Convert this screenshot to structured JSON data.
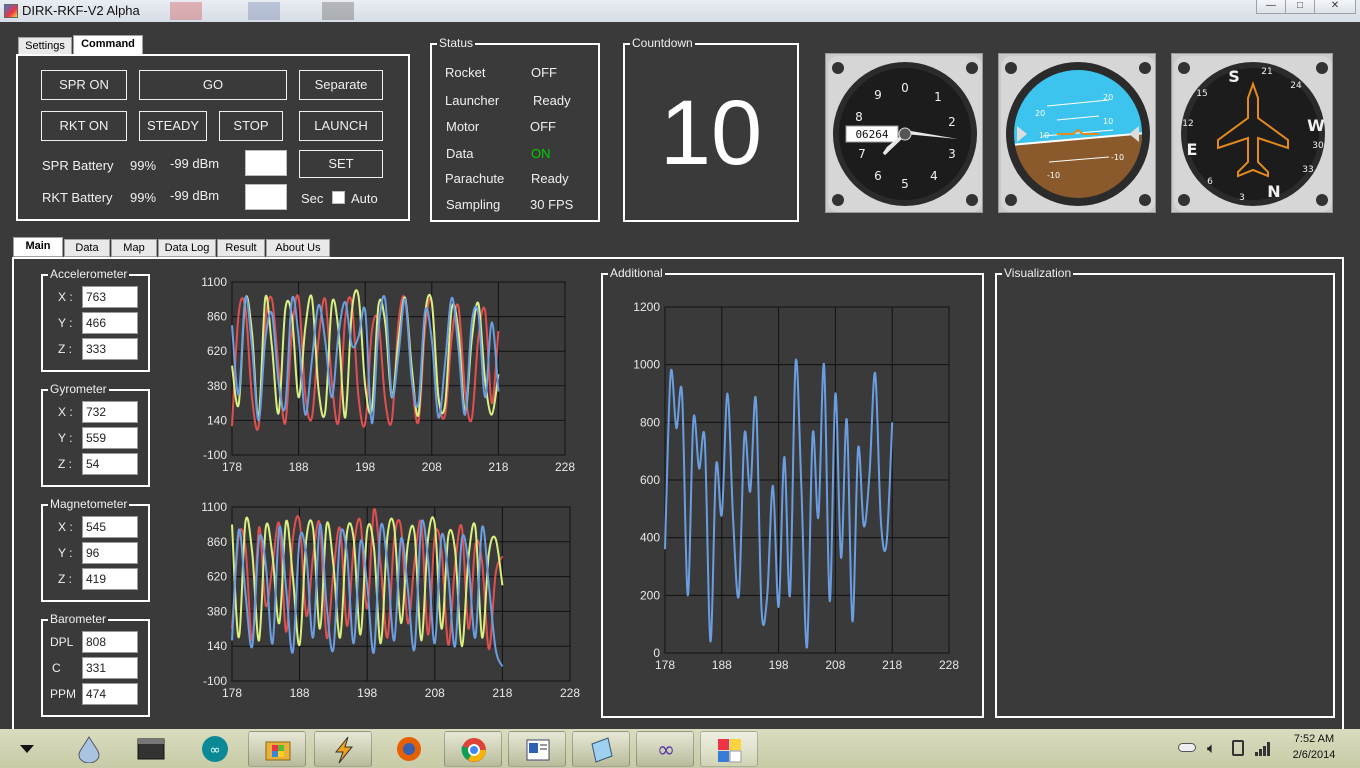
{
  "window": {
    "title": "DIRK-RKF-V2 Alpha",
    "controls": {
      "minimize": "—",
      "maximize": "□",
      "close": "✕"
    }
  },
  "top_tabs": {
    "settings": "Settings",
    "command": "Command"
  },
  "command": {
    "spr_on": "SPR ON",
    "go": "GO",
    "separate": "Separate",
    "rkt_on": "RKT ON",
    "steady": "STEADY",
    "stop": "STOP",
    "launch": "LAUNCH",
    "spr_battery": {
      "label": "SPR Battery",
      "pct": "99%",
      "dbm": "-99 dBm"
    },
    "rkt_battery": {
      "label": "RKT Battery",
      "pct": "99%",
      "dbm": "-99 dBm"
    },
    "set": "SET",
    "sec": "Sec",
    "auto": "Auto"
  },
  "status": {
    "title": "Status",
    "rows": [
      {
        "label": "Rocket",
        "value": "OFF"
      },
      {
        "label": "Launcher",
        "value": "Ready"
      },
      {
        "label": "Motor",
        "value": "OFF"
      },
      {
        "label": "Data",
        "value": "ON"
      },
      {
        "label": "Parachute",
        "value": "Ready"
      },
      {
        "label": "Sampling",
        "value": "30 FPS"
      }
    ],
    "on_color": "#00d000"
  },
  "countdown": {
    "title": "Countdown",
    "value": "10"
  },
  "gauges": {
    "altimeter": {
      "numbers": [
        "0",
        "1",
        "2",
        "3",
        "4",
        "5",
        "6",
        "7",
        "8",
        "9"
      ],
      "counter": "06264"
    },
    "attitude": {
      "pitch_labels": [
        "20",
        "10",
        "-10"
      ]
    },
    "heading": {
      "letters": [
        "S",
        "W",
        "N",
        "E"
      ],
      "numbers": [
        "21",
        "24",
        "30",
        "33",
        "3",
        "6",
        "12",
        "15"
      ]
    }
  },
  "main_tabs": [
    "Main",
    "Data",
    "Map",
    "Data Log",
    "Result",
    "About Us"
  ],
  "sensors": {
    "accelerometer": {
      "title": "Accelerometer",
      "rows": [
        {
          "label": "X :",
          "value": "763"
        },
        {
          "label": "Y :",
          "value": "466"
        },
        {
          "label": "Z :",
          "value": "333"
        }
      ]
    },
    "gyrometer": {
      "title": "Gyrometer",
      "rows": [
        {
          "label": "X :",
          "value": "732"
        },
        {
          "label": "Y :",
          "value": "559"
        },
        {
          "label": "Z :",
          "value": "54"
        }
      ]
    },
    "magnetometer": {
      "title": "Magnetometer",
      "rows": [
        {
          "label": "X :",
          "value": "545"
        },
        {
          "label": "Y :",
          "value": "96"
        },
        {
          "label": "Z :",
          "value": "419"
        }
      ]
    },
    "barometer": {
      "title": "Barometer",
      "rows": [
        {
          "label": "DPL",
          "value": "808"
        },
        {
          "label": "C",
          "value": "331"
        },
        {
          "label": "PPM",
          "value": "474"
        }
      ]
    }
  },
  "panels": {
    "additional": "Additional",
    "visualization": "Visualization"
  },
  "chart_data": [
    {
      "type": "line",
      "x": [
        178,
        179,
        180,
        181,
        182,
        183,
        184,
        185,
        186,
        187,
        188,
        189,
        190,
        191,
        192,
        193,
        194,
        195,
        196,
        197,
        198,
        199,
        200,
        201,
        202,
        203,
        204,
        205,
        206,
        207,
        208,
        209,
        210,
        211,
        212,
        213,
        214,
        215,
        216,
        217,
        218
      ],
      "series": [
        {
          "values": [
            100,
            880,
            920,
            300,
            100,
            820,
            980,
            500,
            120,
            760,
            990,
            320,
            160,
            700,
            980,
            400,
            130,
            850,
            950,
            300,
            120,
            760,
            820,
            280,
            140,
            820,
            980,
            420,
            130,
            780,
            960,
            300,
            180,
            720,
            930,
            340,
            150,
            720,
            900,
            260,
            760
          ],
          "color": "#e05050"
        },
        {
          "values": [
            520,
            250,
            980,
            750,
            160,
            990,
            650,
            190,
            910,
            860,
            300,
            780,
            990,
            350,
            200,
            950,
            760,
            160,
            900,
            1000,
            380,
            220,
            940,
            820,
            300,
            700,
            990,
            500,
            180,
            880,
            960,
            300,
            250,
            920,
            760,
            200,
            700,
            950,
            420,
            180,
            460
          ],
          "color": "#d8f080"
        },
        {
          "values": [
            800,
            320,
            990,
            650,
            140,
            700,
            880,
            400,
            240,
            980,
            720,
            180,
            560,
            940,
            690,
            300,
            740,
            960,
            660,
            720,
            900,
            120,
            780,
            980,
            310,
            600,
            980,
            420,
            260,
            900,
            700,
            160,
            540,
            990,
            640,
            180,
            820,
            880,
            300,
            820,
            340
          ],
          "color": "#6a9ee0"
        }
      ],
      "xlim": [
        178,
        228
      ],
      "ylim": [
        -100,
        1100
      ],
      "yticks": [
        -100,
        140,
        380,
        620,
        860,
        1100
      ],
      "xticks": [
        178,
        188,
        198,
        208,
        218,
        228
      ],
      "grid": true
    },
    {
      "type": "line",
      "x": [
        178,
        179,
        180,
        181,
        182,
        183,
        184,
        185,
        186,
        187,
        188,
        189,
        190,
        191,
        192,
        193,
        194,
        195,
        196,
        197,
        198,
        199,
        200,
        201,
        202,
        203,
        204,
        205,
        206,
        207,
        208,
        209,
        210,
        211,
        212,
        213,
        214,
        215,
        216,
        217,
        218
      ],
      "series": [
        {
          "values": [
            260,
            900,
            820,
            180,
            960,
            420,
            700,
            980,
            240,
            880,
            1000,
            350,
            760,
            980,
            200,
            650,
            950,
            280,
            820,
            1000,
            400,
            1080,
            700,
            200,
            880,
            960,
            300,
            720,
            990,
            220,
            900,
            800,
            150,
            700,
            960,
            260,
            840,
            720,
            120,
            640,
            760
          ],
          "color": "#e05050"
        },
        {
          "values": [
            980,
            200,
            1000,
            780,
            180,
            960,
            760,
            300,
            1000,
            620,
            150,
            880,
            950,
            260,
            980,
            700,
            200,
            920,
            880,
            220,
            940,
            820,
            160,
            900,
            960,
            300,
            840,
            920,
            180,
            880,
            980,
            260,
            900,
            800,
            140,
            760,
            960,
            200,
            780,
            880,
            560
          ],
          "color": "#d8f080"
        },
        {
          "values": [
            180,
            940,
            500,
            140,
            880,
            700,
            160,
            960,
            540,
            100,
            880,
            760,
            200,
            980,
            420,
            120,
            900,
            780,
            160,
            860,
            560,
            100,
            960,
            700,
            180,
            880,
            540,
            120,
            980,
            740,
            160,
            900,
            620,
            140,
            880,
            700,
            200,
            960,
            560,
            120,
            0
          ],
          "color": "#6a9ee0"
        }
      ],
      "xlim": [
        178,
        228
      ],
      "ylim": [
        -100,
        1100
      ],
      "yticks": [
        -100,
        140,
        380,
        620,
        860,
        1100
      ],
      "xticks": [
        178,
        188,
        198,
        208,
        218,
        228
      ],
      "grid": true
    },
    {
      "type": "line",
      "x": [
        178,
        179,
        180,
        181,
        182,
        183,
        184,
        185,
        186,
        187,
        188,
        189,
        190,
        191,
        192,
        193,
        194,
        195,
        196,
        197,
        198,
        199,
        200,
        201,
        202,
        203,
        204,
        205,
        206,
        207,
        208,
        209,
        210,
        211,
        212,
        213,
        214,
        215,
        216,
        217,
        218
      ],
      "series": [
        {
          "values": [
            360,
            970,
            780,
            900,
            200,
            810,
            640,
            740,
            40,
            650,
            480,
            900,
            460,
            200,
            760,
            560,
            880,
            150,
            200,
            580,
            160,
            680,
            200,
            1010,
            580,
            20,
            760,
            470,
            1000,
            180,
            900,
            330,
            810,
            110,
            710,
            440,
            620,
            970,
            460,
            380,
            800
          ],
          "color": "#6a9ee0"
        }
      ],
      "xlim": [
        178,
        228
      ],
      "ylim": [
        0,
        1200
      ],
      "yticks": [
        0,
        200,
        400,
        600,
        800,
        1000,
        1200
      ],
      "xticks": [
        178,
        188,
        198,
        208,
        218,
        228
      ],
      "grid": true
    }
  ],
  "taskbar": {
    "clock_time": "7:52 AM",
    "clock_date": "2/6/2014",
    "items": [
      "droplet-icon",
      "terminal-icon",
      "arduino-icon",
      "windows-explorer-icon",
      "winamp-icon",
      "firefox-icon",
      "chrome-icon",
      "document-icon",
      "notepad-icon",
      "visual-studio-icon",
      "rkf-app-icon"
    ]
  }
}
